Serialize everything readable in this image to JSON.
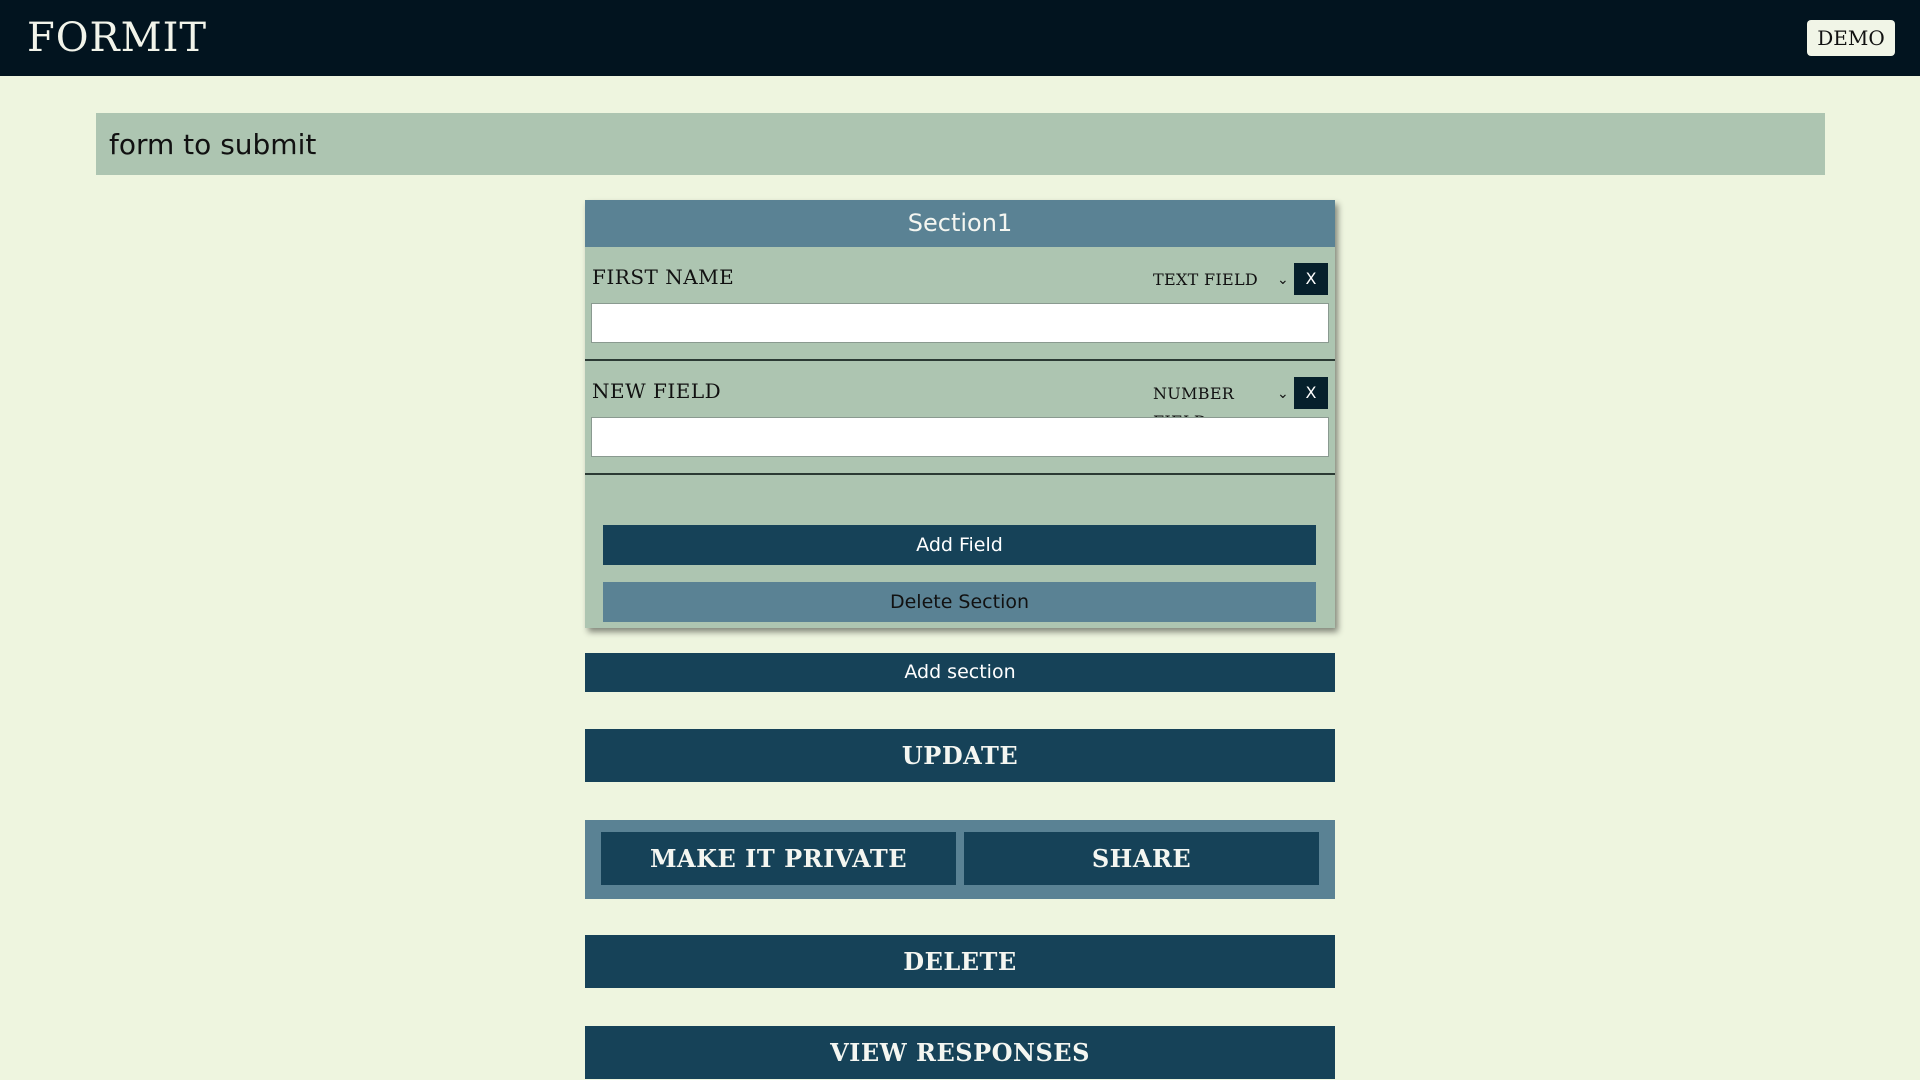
{
  "header": {
    "logo": "FORMIT",
    "demo_label": "DEMO"
  },
  "form": {
    "title_value": "form to submit",
    "sections": [
      {
        "title": "Section1",
        "fields": [
          {
            "label": "FIRST NAME",
            "type": "TEXT FIELD",
            "value": ""
          },
          {
            "label": "NEW FIELD",
            "type": "NUMBER FIELD",
            "value": ""
          }
        ],
        "remove_label": "X",
        "add_field_label": "Add Field",
        "delete_section_label": "Delete Section"
      }
    ],
    "add_section_label": "Add section"
  },
  "actions": {
    "update": "UPDATE",
    "make_private": "MAKE IT PRIVATE",
    "share": "SHARE",
    "delete": "DELETE",
    "view_responses": "VIEW RESPONSES"
  },
  "icons": {
    "dropdown": "chevron-down-icon"
  },
  "colors": {
    "background": "#eef5df",
    "topbar": "#02141f",
    "primary": "#164258",
    "secondary": "#5a8294",
    "panel": "#adc5b1"
  }
}
